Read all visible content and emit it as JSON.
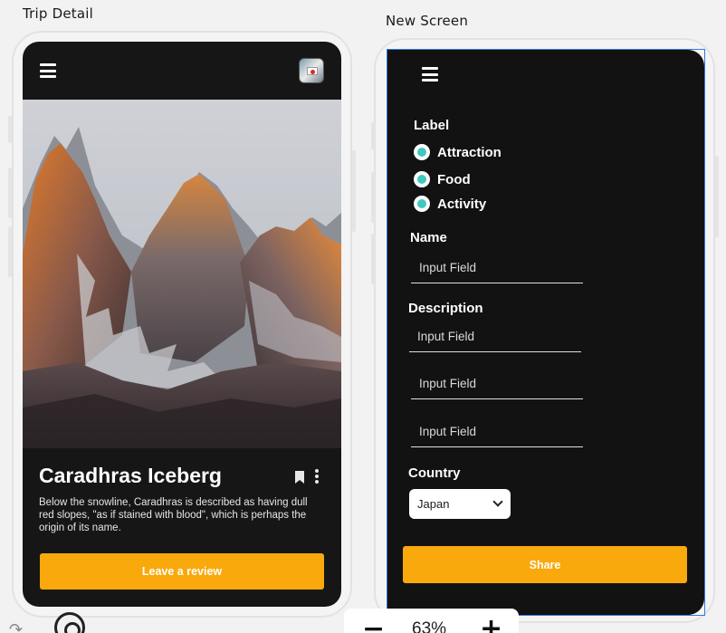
{
  "frames": {
    "left_title": "Trip Detail",
    "right_title": "New Screen"
  },
  "trip_detail": {
    "title": "Caradhras Iceberg",
    "description": "Below the snowline, Caradhras is described as having dull red slopes, \"as if stained with blood\", which is perhaps the origin of its name.",
    "review_button": "Leave a review",
    "icons": [
      "hamburger-menu-icon",
      "avatar-flag",
      "bookmark-icon",
      "more-vertical-icon"
    ]
  },
  "new_screen": {
    "label_heading": "Label",
    "radio_options": [
      "Attraction",
      "Food",
      "Activity"
    ],
    "name_heading": "Name",
    "name_placeholder": "Input Field",
    "description_heading": "Description",
    "description_placeholders": [
      "Input Field",
      "Input Field",
      "Input Field"
    ],
    "country_heading": "Country",
    "country_selected": "Japan",
    "share_button": "Share"
  },
  "toolbar": {
    "zoom_level": "63%",
    "zoom_out": "−",
    "zoom_in": "+"
  },
  "colors": {
    "accent_orange": "#f9a90c",
    "radio_teal": "#3fc9be",
    "selection_blue": "#2f7be3",
    "screen_dark": "#161616"
  }
}
